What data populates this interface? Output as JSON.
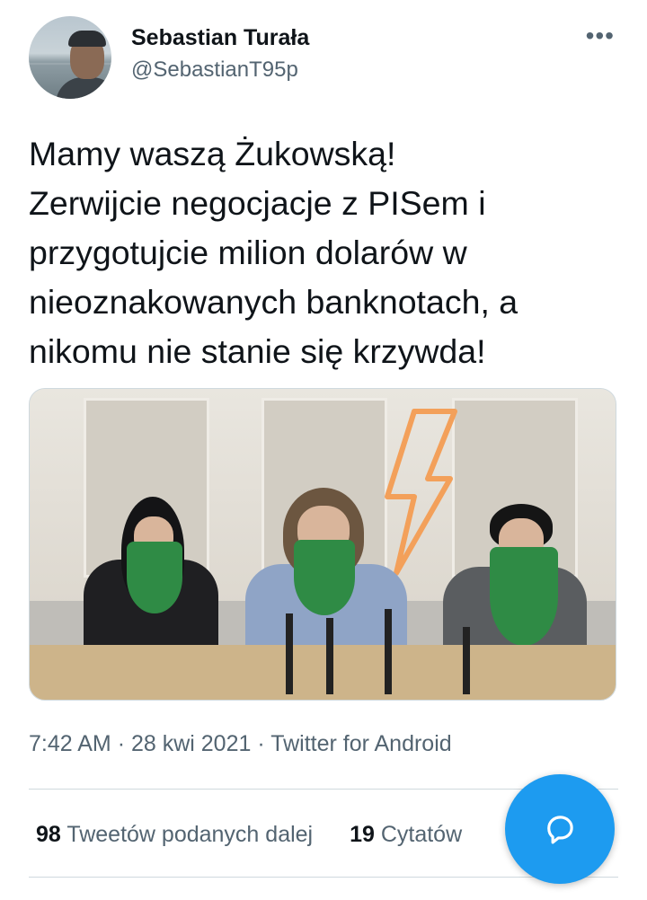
{
  "author": {
    "name": "Sebastian Turała",
    "handle": "@SebastianT95p"
  },
  "menu": {
    "more_label": "•••"
  },
  "tweet": {
    "text": "Mamy waszą Żukowską!\nZerwijcie negocjacje z PISem i\nprzygotujcie milion dolarów w\nnieoznakowanych banknotach, a\nnikomu nie stanie się krzywda!"
  },
  "meta": {
    "time": "7:42 AM",
    "date": "28 kwi 2021",
    "source": "Twitter for Android",
    "separator": "·"
  },
  "stats": {
    "retweets_count": "98",
    "retweets_label": "Tweetów podanych dalej",
    "quotes_count": "19",
    "quotes_label": "Cytatów"
  },
  "colors": {
    "accent": "#1d9bf0",
    "text_primary": "#0f1419",
    "text_secondary": "#536471",
    "divider": "#cfd9de"
  },
  "icons": {
    "more": "more-dots-icon",
    "compose": "compose-reply-icon"
  }
}
